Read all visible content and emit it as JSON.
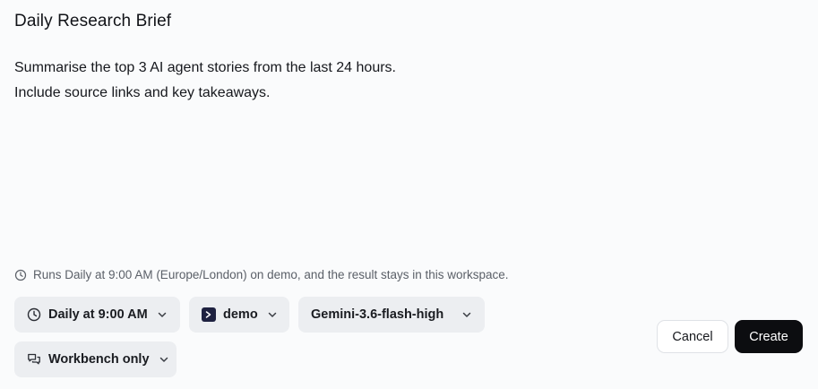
{
  "header": {
    "title": "Daily Research Brief"
  },
  "prompt": {
    "lines": [
      "Summarise the top 3 AI agent stories from the last 24 hours.",
      "Include source links and key takeaways."
    ]
  },
  "schedule_note": {
    "text": "Runs Daily at 9:00 AM (Europe/London) on demo, and the result stays in this workspace."
  },
  "options": {
    "schedule": {
      "label": "Daily at 9:00 AM",
      "icon": "clock-icon"
    },
    "workspace": {
      "label": "demo",
      "icon": "terminal-icon",
      "icon_color": "#1e2140"
    },
    "model": {
      "label": "Gemini-3.6-flash-high"
    },
    "scope": {
      "label": "Workbench only",
      "icon": "chat-bubbles-icon"
    }
  },
  "actions": {
    "cancel_label": "Cancel",
    "create_label": "Create"
  },
  "colors": {
    "background": "#fafbfc",
    "chip_bg": "#eceef1",
    "primary_button": "#0c0d10"
  }
}
